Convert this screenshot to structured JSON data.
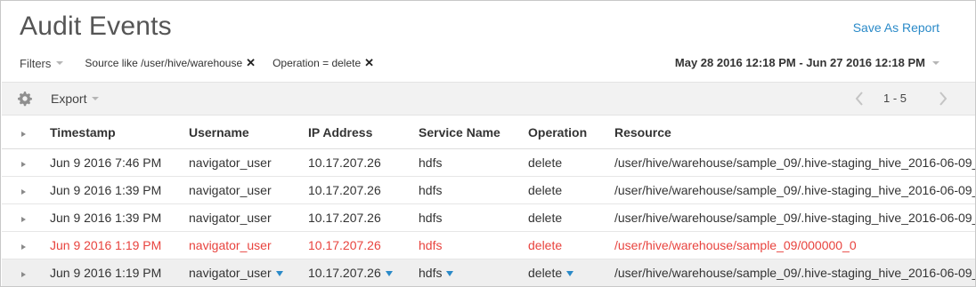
{
  "header": {
    "title": "Audit Events",
    "save_report_label": "Save As Report"
  },
  "filters": {
    "label": "Filters",
    "chips": [
      {
        "text": "Source like /user/hive/warehouse"
      },
      {
        "text": "Operation = delete"
      }
    ],
    "date_range": "May 28 2016 12:18 PM - Jun 27 2016 12:18 PM"
  },
  "toolbar": {
    "export_label": "Export",
    "pager_range": "1 - 5"
  },
  "table": {
    "columns": [
      "Timestamp",
      "Username",
      "IP Address",
      "Service Name",
      "Operation",
      "Resource"
    ],
    "rows": [
      {
        "timestamp": "Jun 9 2016 7:46 PM",
        "username": "navigator_user",
        "ip": "10.17.207.26",
        "service": "hdfs",
        "operation": "delete",
        "resource": "/user/hive/warehouse/sample_09/.hive-staging_hive_2016-06-09_",
        "state": "normal"
      },
      {
        "timestamp": "Jun 9 2016 1:39 PM",
        "username": "navigator_user",
        "ip": "10.17.207.26",
        "service": "hdfs",
        "operation": "delete",
        "resource": "/user/hive/warehouse/sample_09/.hive-staging_hive_2016-06-09_",
        "state": "normal"
      },
      {
        "timestamp": "Jun 9 2016 1:39 PM",
        "username": "navigator_user",
        "ip": "10.17.207.26",
        "service": "hdfs",
        "operation": "delete",
        "resource": "/user/hive/warehouse/sample_09/.hive-staging_hive_2016-06-09_",
        "state": "normal"
      },
      {
        "timestamp": "Jun 9 2016 1:19 PM",
        "username": "navigator_user",
        "ip": "10.17.207.26",
        "service": "hdfs",
        "operation": "delete",
        "resource": "/user/hive/warehouse/sample_09/000000_0",
        "state": "highlight"
      },
      {
        "timestamp": "Jun 9 2016 1:19 PM",
        "username": "navigator_user",
        "ip": "10.17.207.26",
        "service": "hdfs",
        "operation": "delete",
        "resource": "/user/hive/warehouse/sample_09/.hive-staging_hive_2016-06-09_",
        "state": "hovered"
      }
    ]
  },
  "colors": {
    "link": "#2a8ac8",
    "highlight_text": "#e8433e",
    "hover_row": "#efefef",
    "toolbar_bg": "#f2f2f2"
  },
  "icons": [
    "gear-icon",
    "caret-down-icon",
    "close-icon",
    "chevron-left-icon",
    "chevron-right-icon",
    "expand-arrow-icon",
    "filter-icon"
  ]
}
